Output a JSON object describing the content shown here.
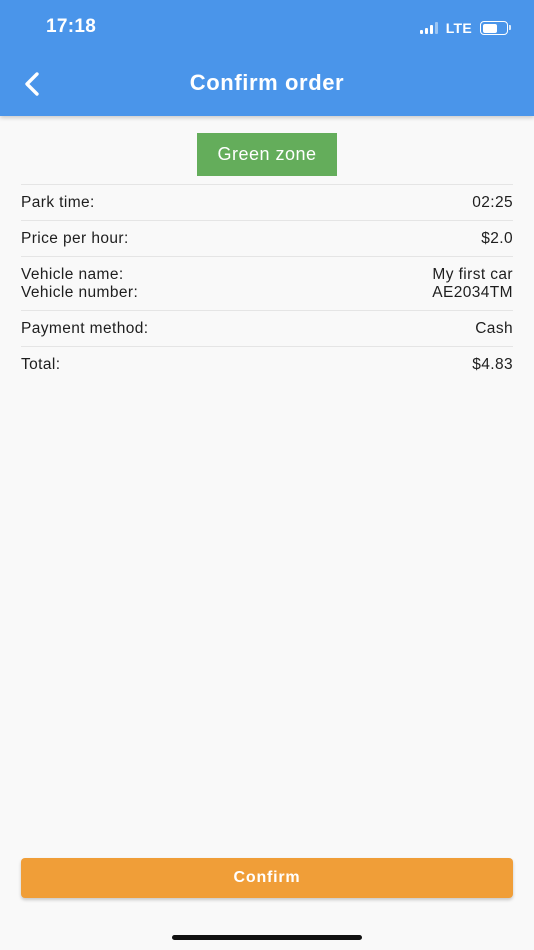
{
  "status_bar": {
    "time": "17:18",
    "network": "LTE",
    "battery_level": 0.62
  },
  "header": {
    "title": "Confirm order",
    "background_color": "#4a95ea"
  },
  "zone": {
    "label": "Green zone",
    "color": "#64ad5b"
  },
  "details": {
    "park_time": {
      "label": "Park time:",
      "value": "02:25"
    },
    "price_per_hour": {
      "label": "Price per hour:",
      "value": "$2.0"
    },
    "vehicle_name": {
      "label": "Vehicle name:",
      "value": "My first car"
    },
    "vehicle_number": {
      "label": "Vehicle number:",
      "value": "AE2034TM"
    },
    "payment_method": {
      "label": "Payment method:",
      "value": "Cash"
    },
    "total": {
      "label": "Total:",
      "value": "$4.83"
    }
  },
  "actions": {
    "confirm_label": "Confirm",
    "confirm_color": "#f09e38"
  }
}
